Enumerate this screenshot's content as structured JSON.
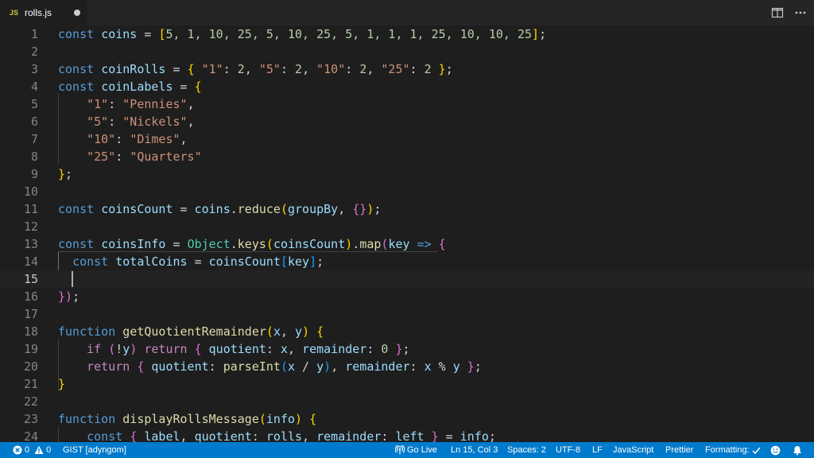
{
  "tab": {
    "lang_badge": "JS",
    "filename": "rolls.js"
  },
  "line_numbers": [
    "1",
    "2",
    "3",
    "4",
    "5",
    "6",
    "7",
    "8",
    "9",
    "10",
    "11",
    "12",
    "13",
    "14",
    "15",
    "16",
    "17",
    "18",
    "19",
    "20",
    "21",
    "22",
    "23",
    "24"
  ],
  "active_line": "15",
  "code": {
    "l1": {
      "kw": "const",
      "name": "coins",
      "eq": " = ",
      "open": "[",
      "vals": "5, 1, 10, 25, 5, 10, 25, 5, 1, 1, 1, 25, 10, 10, 25",
      "close": "]",
      "end": ";"
    },
    "l3": {
      "kw": "const",
      "name": "coinRolls",
      "eq": " = ",
      "open": "{",
      "k1": "\"1\"",
      "v1": "2",
      "k2": "\"5\"",
      "v2": "2",
      "k3": "\"10\"",
      "v3": "2",
      "k4": "\"25\"",
      "v4": "2",
      "close": "}",
      "end": ";"
    },
    "l4": {
      "kw": "const",
      "name": "coinLabels",
      "eq": " = ",
      "open": "{"
    },
    "l5": {
      "key": "\"1\"",
      "val": "\"Pennies\"",
      "end": ","
    },
    "l6": {
      "key": "\"5\"",
      "val": "\"Nickels\"",
      "end": ","
    },
    "l7": {
      "key": "\"10\"",
      "val": "\"Dimes\"",
      "end": ","
    },
    "l8": {
      "key": "\"25\"",
      "val": "\"Quarters\""
    },
    "l9": {
      "close": "}",
      "end": ";"
    },
    "l11": {
      "kw": "const",
      "name": "coinsCount",
      "eq": " = ",
      "obj": "coins",
      "dot": ".",
      "fn": "reduce",
      "open": "(",
      "arg": "groupBy",
      "comma": ", ",
      "braces": "{}",
      "close": ")",
      "end": ";"
    },
    "l13": {
      "kw": "const",
      "name": "coinsInfo",
      "eq": " = ",
      "cls": "Object",
      "dot": ".",
      "fn": "keys",
      "open": "(",
      "arg": "coinsCount",
      "close": ")",
      "dot2": ".",
      "fn2": "map",
      "open2": "(",
      "param": "key",
      "arrow": " => ",
      "brace": "{"
    },
    "l14": {
      "kw": "const",
      "name": "totalCoins",
      "eq": " = ",
      "obj": "coinsCount",
      "open": "[",
      "key": "key",
      "close": "]",
      "end": ";"
    },
    "l16": {
      "brace": "}",
      "paren": ")",
      "end": ";"
    },
    "l18": {
      "kw": "function",
      "fn": "getQuotientRemainder",
      "open": "(",
      "p1": "x",
      "comma": ", ",
      "p2": "y",
      "close": ")",
      "brace": "{"
    },
    "l19": {
      "kw": "if",
      "open": "(",
      "bang": "!",
      "var": "y",
      "close": ")",
      "ret": "return",
      "brace": "{",
      "k1": "quotient",
      "colon": ": ",
      "v1": "x",
      "comma": ", ",
      "k2": "remainder",
      "v2": "0",
      "brace2": "}",
      "end": ";"
    },
    "l20": {
      "ret": "return",
      "brace": "{",
      "k1": "quotient",
      "colon": ": ",
      "fn": "parseInt",
      "open": "(",
      "a": "x",
      "div": " / ",
      "b": "y",
      "close": ")",
      "comma": ", ",
      "k2": "remainder",
      "v1": "x",
      "mod": " % ",
      "v2": "y",
      "brace2": "}",
      "end": ";"
    },
    "l21": {
      "brace": "}"
    },
    "l23": {
      "kw": "function",
      "fn": "displayRollsMessage",
      "open": "(",
      "param": "info",
      "close": ")",
      "brace": "{"
    },
    "l24": {
      "kw": "const",
      "brace": "{",
      "a": "label",
      "comma": ", ",
      "b": "quotient",
      "colon": ": ",
      "c": "rolls",
      "d": "remainder",
      "e": "left",
      "brace2": "}",
      "eq": " = ",
      "f": "info",
      "end": ";"
    }
  },
  "status": {
    "errors": "0",
    "warnings": "0",
    "gist": "GIST [adyngom]",
    "go_live": "Go Live",
    "position": "Ln 15, Col 3",
    "spaces": "Spaces: 2",
    "encoding": "UTF-8",
    "eol": "LF",
    "language": "JavaScript",
    "prettier": "Prettier",
    "formatting": "Formatting:"
  },
  "colors": {
    "statusbar": "#007acc",
    "editor_bg": "#1e1e1e",
    "tab_bg": "#252526"
  }
}
